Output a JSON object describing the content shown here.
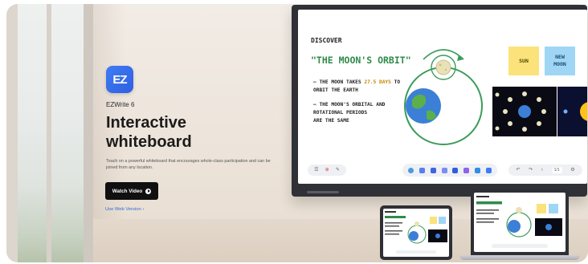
{
  "hero": {
    "app_name": "EZWrite 6",
    "app_icon_letters": "EZ",
    "headline_line1": "Interactive",
    "headline_line2": "whiteboard",
    "description": "Teach on a powerful whiteboard that encourages whole-class participation and can be joined from any location.",
    "watch_button_label": "Watch Video",
    "web_link_label": "Use Web Version",
    "web_link_arrow": "›"
  },
  "whiteboard": {
    "heading": "Discover",
    "title": "\"The Moon's orbit\"",
    "bullet1_prefix": "– The Moon takes ",
    "bullet1_highlight": "27.5 days",
    "bullet1_suffix": " to orbit the Earth",
    "bullet2_line1": "– The Moon's orbital and",
    "bullet2_line2": "rotational periods",
    "bullet2_line3": "are the same",
    "sticky_sun": "Sun",
    "sticky_new_moon_line1": "New",
    "sticky_new_moon_line2": "Moon",
    "page_indicator": "1/1"
  },
  "colors": {
    "brand_blue": "#3f7cf4",
    "title_green": "#2f8a4a",
    "sticky_yellow": "#fbe27a",
    "sticky_blue": "#9fd6f6",
    "button_black": "#101010",
    "link_blue": "#2e6bd8"
  },
  "icons": [
    "menu-icon",
    "add-icon",
    "pen-icon",
    "play-icon",
    "chevron-right-icon",
    "undo-icon",
    "redo-icon",
    "settings-icon"
  ]
}
